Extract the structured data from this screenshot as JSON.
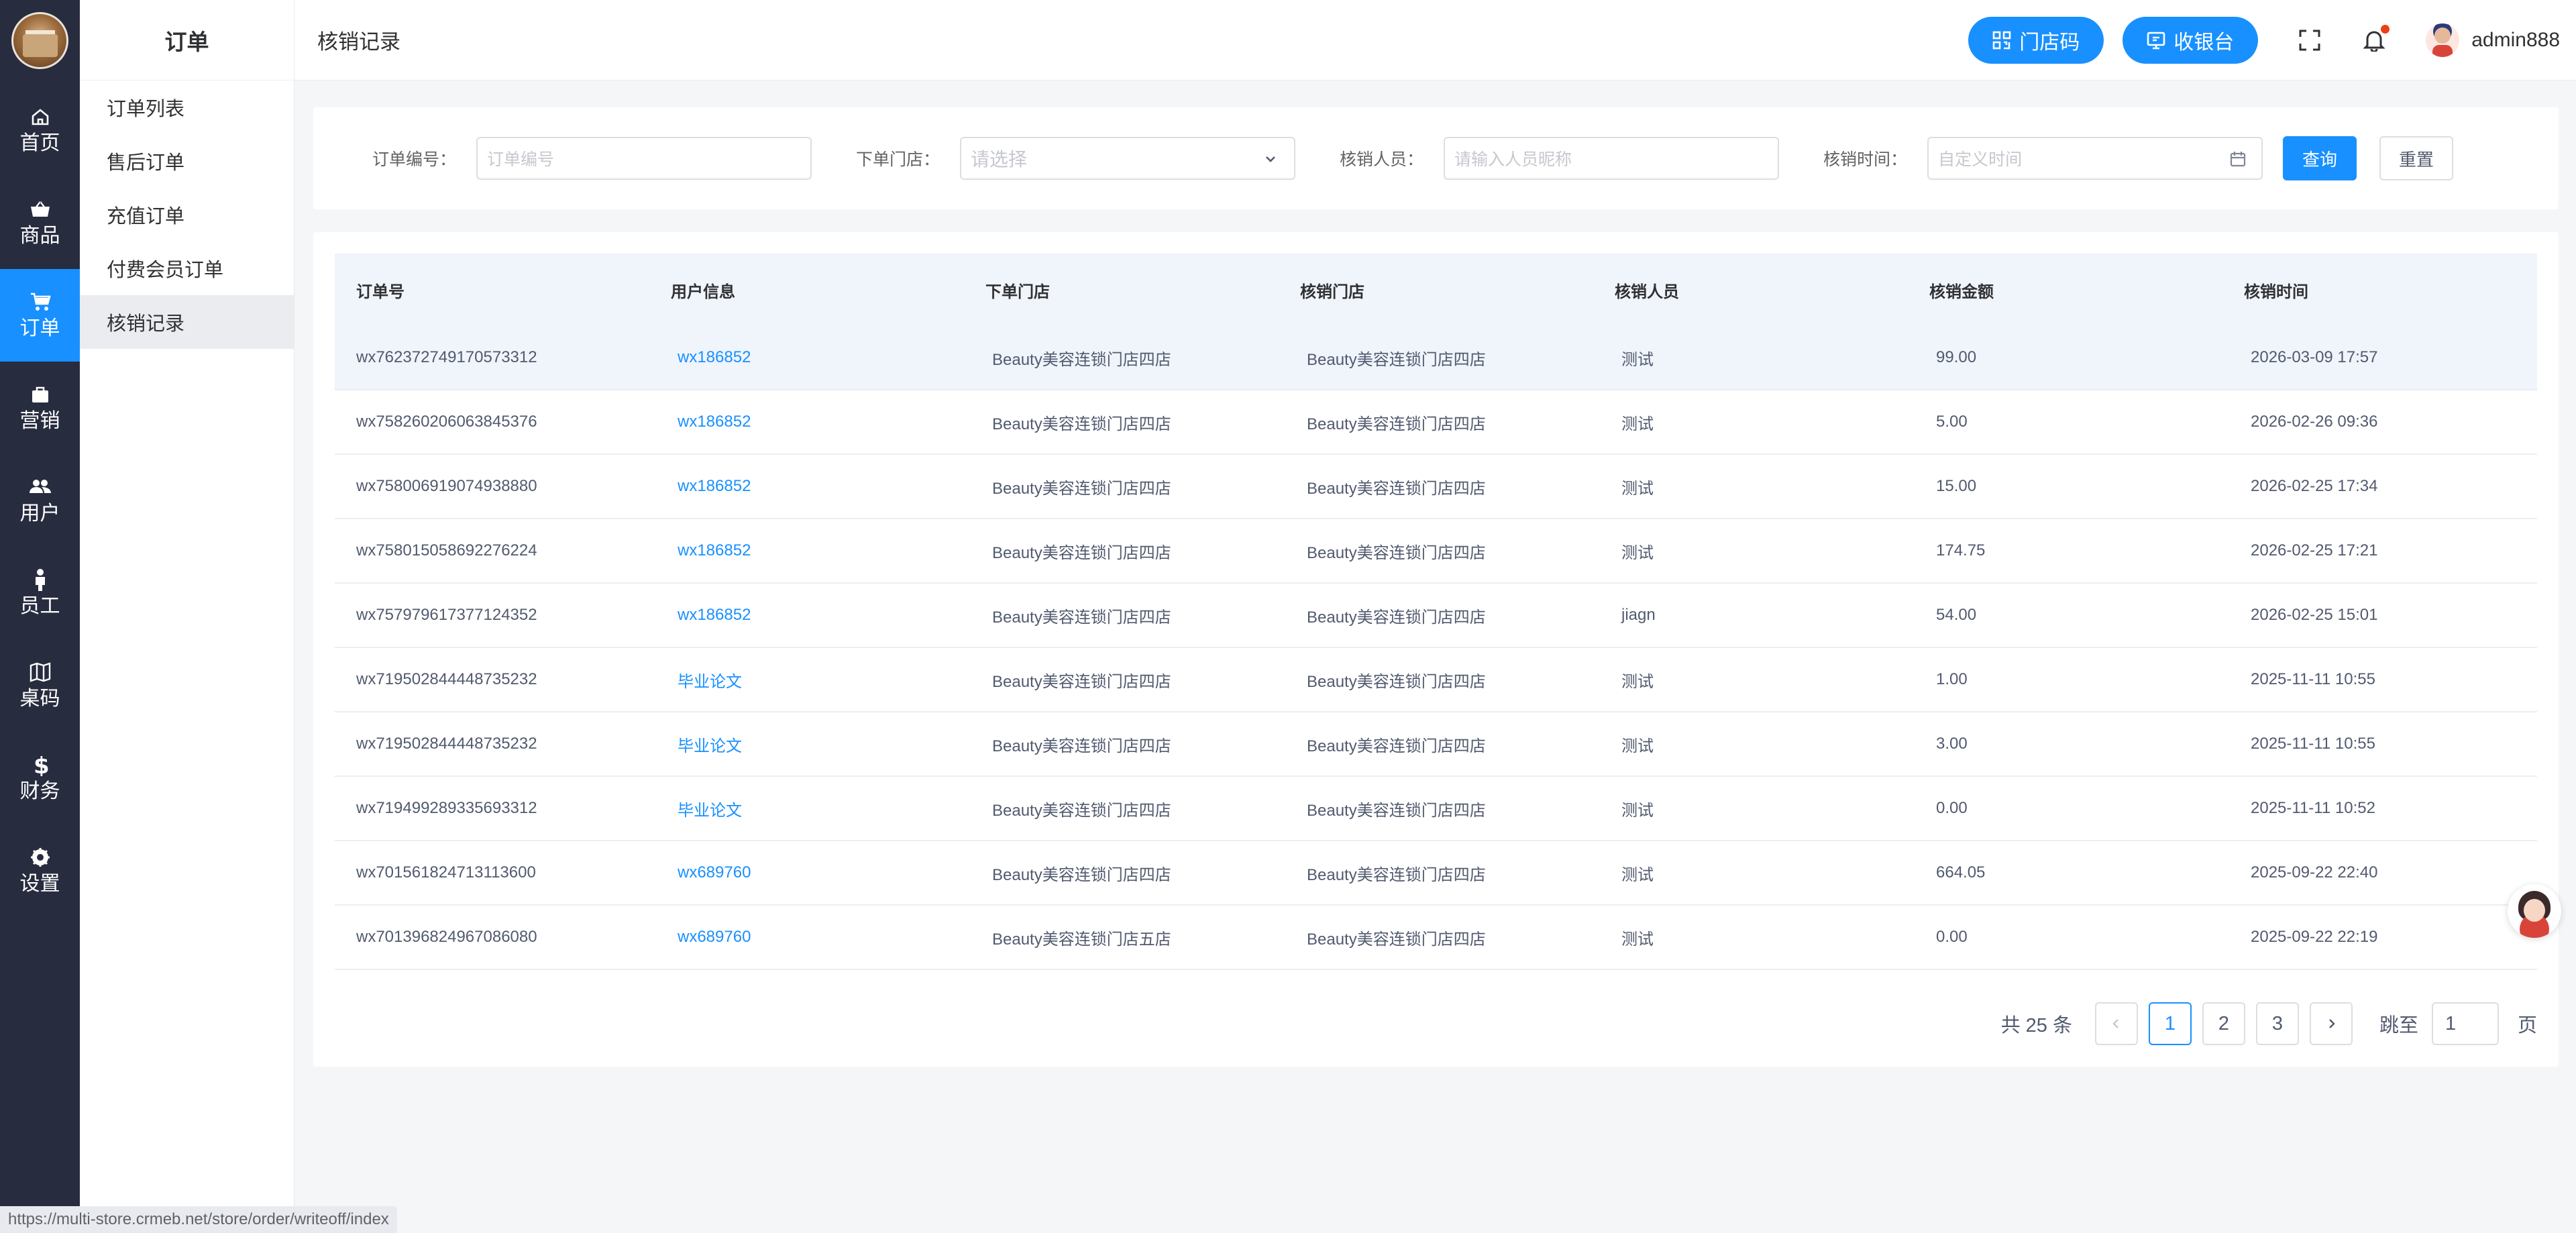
{
  "rail": {
    "items": [
      {
        "label": "首页",
        "icon": "home-icon"
      },
      {
        "label": "商品",
        "icon": "basket-icon"
      },
      {
        "label": "订单",
        "icon": "cart-icon",
        "active": true
      },
      {
        "label": "营销",
        "icon": "bag-icon"
      },
      {
        "label": "用户",
        "icon": "users-icon"
      },
      {
        "label": "员工",
        "icon": "person-icon"
      },
      {
        "label": "桌码",
        "icon": "map-icon"
      },
      {
        "label": "财务",
        "icon": "dollar-icon"
      },
      {
        "label": "设置",
        "icon": "settings-icon"
      }
    ]
  },
  "submenu": {
    "title": "订单",
    "items": [
      "订单列表",
      "售后订单",
      "充值订单",
      "付费会员订单",
      "核销记录"
    ],
    "active_index": 4
  },
  "header": {
    "title": "核销记录",
    "store_code_label": "门店码",
    "cashier_label": "收银台",
    "username": "admin888"
  },
  "filter": {
    "order_no_label": "订单编号：",
    "order_no_placeholder": "订单编号",
    "store_label": "下单门店：",
    "store_placeholder": "请选择",
    "staff_label": "核销人员：",
    "staff_placeholder": "请输入人员昵称",
    "time_label": "核销时间：",
    "time_placeholder": "自定义时间",
    "query_label": "查询",
    "reset_label": "重置"
  },
  "table": {
    "headers": [
      "订单号",
      "用户信息",
      "下单门店",
      "核销门店",
      "核销人员",
      "核销金额",
      "核销时间"
    ],
    "rows": [
      [
        "wx762372749170573312",
        "wx186852",
        "Beauty美容连锁门店四店",
        "Beauty美容连锁门店四店",
        "测试",
        "99.00",
        "2026-03-09 17:57"
      ],
      [
        "wx758260206063845376",
        "wx186852",
        "Beauty美容连锁门店四店",
        "Beauty美容连锁门店四店",
        "测试",
        "5.00",
        "2026-02-26 09:36"
      ],
      [
        "wx758006919074938880",
        "wx186852",
        "Beauty美容连锁门店四店",
        "Beauty美容连锁门店四店",
        "测试",
        "15.00",
        "2026-02-25 17:34"
      ],
      [
        "wx758015058692276224",
        "wx186852",
        "Beauty美容连锁门店四店",
        "Beauty美容连锁门店四店",
        "测试",
        "174.75",
        "2026-02-25 17:21"
      ],
      [
        "wx757979617377124352",
        "wx186852",
        "Beauty美容连锁门店四店",
        "Beauty美容连锁门店四店",
        "jiagn",
        "54.00",
        "2026-02-25 15:01"
      ],
      [
        "wx719502844448735232",
        "毕业论文",
        "Beauty美容连锁门店四店",
        "Beauty美容连锁门店四店",
        "测试",
        "1.00",
        "2025-11-11 10:55"
      ],
      [
        "wx719502844448735232",
        "毕业论文",
        "Beauty美容连锁门店四店",
        "Beauty美容连锁门店四店",
        "测试",
        "3.00",
        "2025-11-11 10:55"
      ],
      [
        "wx719499289335693312",
        "毕业论文",
        "Beauty美容连锁门店四店",
        "Beauty美容连锁门店四店",
        "测试",
        "0.00",
        "2025-11-11 10:52"
      ],
      [
        "wx701561824713113600",
        "wx689760",
        "Beauty美容连锁门店四店",
        "Beauty美容连锁门店四店",
        "测试",
        "664.05",
        "2025-09-22 22:40"
      ],
      [
        "wx701396824967086080",
        "wx689760",
        "Beauty美容连锁门店五店",
        "Beauty美容连锁门店四店",
        "测试",
        "0.00",
        "2025-09-22 22:19"
      ]
    ]
  },
  "pager": {
    "total": "共 25 条",
    "pages": [
      "1",
      "2",
      "3"
    ],
    "current": "1",
    "jump_label": "跳至",
    "jump_value": "1",
    "page_suffix": "页"
  },
  "status_url": "https://multi-store.crmeb.net/store/order/writeoff/index",
  "colors": {
    "primary": "#1890ff",
    "rail_bg": "#282c3f",
    "dot": "#ed4014"
  }
}
